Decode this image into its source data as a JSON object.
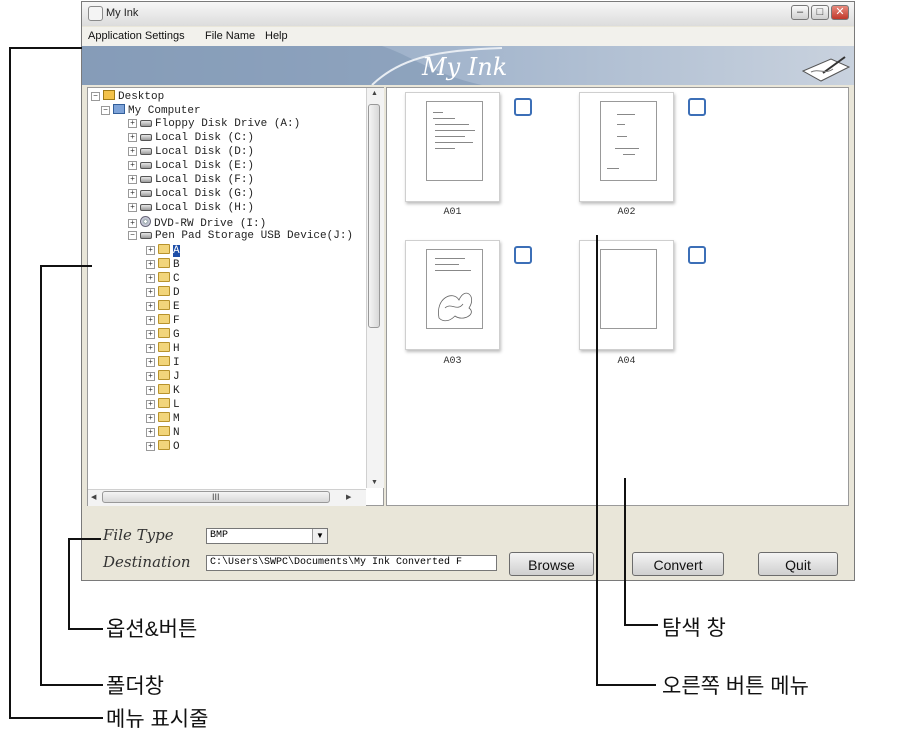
{
  "window": {
    "title": "My Ink",
    "banner_title": "My Ink"
  },
  "menu": [
    "Application Settings",
    "File Name",
    "Help"
  ],
  "tree": {
    "items": [
      {
        "label": "Desktop",
        "icon": "desktop-icon",
        "level": 0,
        "expander": "−"
      },
      {
        "label": "My Computer",
        "icon": "computer-icon",
        "level": 1,
        "expander": "−"
      },
      {
        "label": "Floppy Disk Drive (A:)",
        "icon": "drive-icon",
        "level": 2,
        "expander": "+"
      },
      {
        "label": "Local Disk (C:)",
        "icon": "disk-icon",
        "level": 2,
        "expander": "+"
      },
      {
        "label": "Local Disk (D:)",
        "icon": "disk-icon",
        "level": 2,
        "expander": "+"
      },
      {
        "label": "Local Disk (E:)",
        "icon": "disk-icon",
        "level": 2,
        "expander": "+"
      },
      {
        "label": "Local Disk (F:)",
        "icon": "disk-icon",
        "level": 2,
        "expander": "+"
      },
      {
        "label": "Local Disk (G:)",
        "icon": "disk-icon",
        "level": 2,
        "expander": "+"
      },
      {
        "label": "Local Disk (H:)",
        "icon": "disk-icon",
        "level": 2,
        "expander": "+"
      },
      {
        "label": "DVD-RW Drive (I:)",
        "icon": "dvd-icon",
        "level": 2,
        "expander": "+"
      },
      {
        "label": "Pen Pad Storage USB Device(J:)",
        "icon": "drive-icon",
        "level": 2,
        "expander": "−"
      },
      {
        "label": "A",
        "icon": "folder-icon",
        "level": 3,
        "expander": "+",
        "selected": true
      },
      {
        "label": "B",
        "icon": "folder-icon",
        "level": 3,
        "expander": "+"
      },
      {
        "label": "C",
        "icon": "folder-icon",
        "level": 3,
        "expander": "+"
      },
      {
        "label": "D",
        "icon": "folder-icon",
        "level": 3,
        "expander": "+"
      },
      {
        "label": "E",
        "icon": "folder-icon",
        "level": 3,
        "expander": "+"
      },
      {
        "label": "F",
        "icon": "folder-icon",
        "level": 3,
        "expander": "+"
      },
      {
        "label": "G",
        "icon": "folder-icon",
        "level": 3,
        "expander": "+"
      },
      {
        "label": "H",
        "icon": "folder-icon",
        "level": 3,
        "expander": "+"
      },
      {
        "label": "I",
        "icon": "folder-icon",
        "level": 3,
        "expander": "+"
      },
      {
        "label": "J",
        "icon": "folder-icon",
        "level": 3,
        "expander": "+"
      },
      {
        "label": "K",
        "icon": "folder-icon",
        "level": 3,
        "expander": "+"
      },
      {
        "label": "L",
        "icon": "folder-icon",
        "level": 3,
        "expander": "+"
      },
      {
        "label": "M",
        "icon": "folder-icon",
        "level": 3,
        "expander": "+"
      },
      {
        "label": "N",
        "icon": "folder-icon",
        "level": 3,
        "expander": "+"
      },
      {
        "label": "O",
        "icon": "folder-icon",
        "level": 3,
        "expander": "+"
      }
    ],
    "hscroll_grip": "III"
  },
  "thumbnails": [
    {
      "label": "A01",
      "checked": false
    },
    {
      "label": "A02",
      "checked": false
    },
    {
      "label": "A03",
      "checked": false
    },
    {
      "label": "A04",
      "checked": false
    }
  ],
  "options": {
    "file_type_label": "File Type",
    "file_type_value": "BMP",
    "destination_label": "Destination",
    "destination_value": "C:\\Users\\SWPC\\Documents\\My Ink Converted F",
    "browse_label": "Browse",
    "convert_label": "Convert",
    "quit_label": "Quit"
  },
  "annotations": {
    "options_buttons": "옵션&버튼",
    "folder_pane": "폴더창",
    "menu_bar": "메뉴 표시줄",
    "browse_pane": "탐색 창",
    "right_button_menu": "오른쪽 버튼 메뉴"
  },
  "colors": {
    "banner": "#a4b6cd",
    "selection": "#1d4ea8",
    "checkbox": "#3c6fb7"
  }
}
